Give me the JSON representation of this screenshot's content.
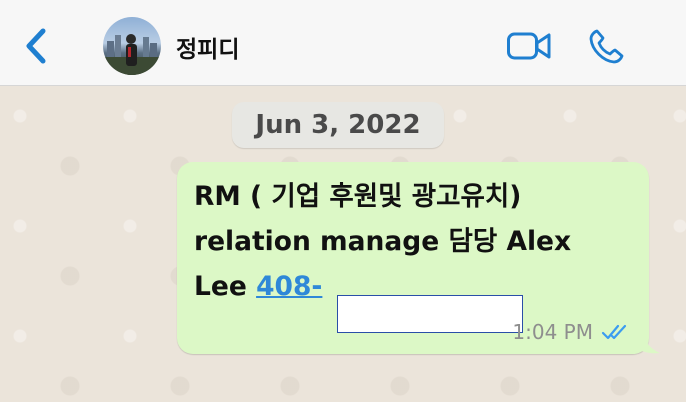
{
  "header": {
    "contact_name": "정피디",
    "back_icon": "chevron-left-icon",
    "video_icon": "video-camera-icon",
    "call_icon": "phone-icon",
    "accent_color": "#2f88d8"
  },
  "chat": {
    "date_label": "Jun 3, 2022",
    "message": {
      "line1": "RM ( 기업 후원및 광고유치)",
      "line2": "relation manage 담당 Alex",
      "line3_prefix": "Lee ",
      "phone_visible": "408-",
      "time": "1:04 PM",
      "status_icon": "double-check-read-icon",
      "bubble_color": "#dcf8c6"
    }
  }
}
